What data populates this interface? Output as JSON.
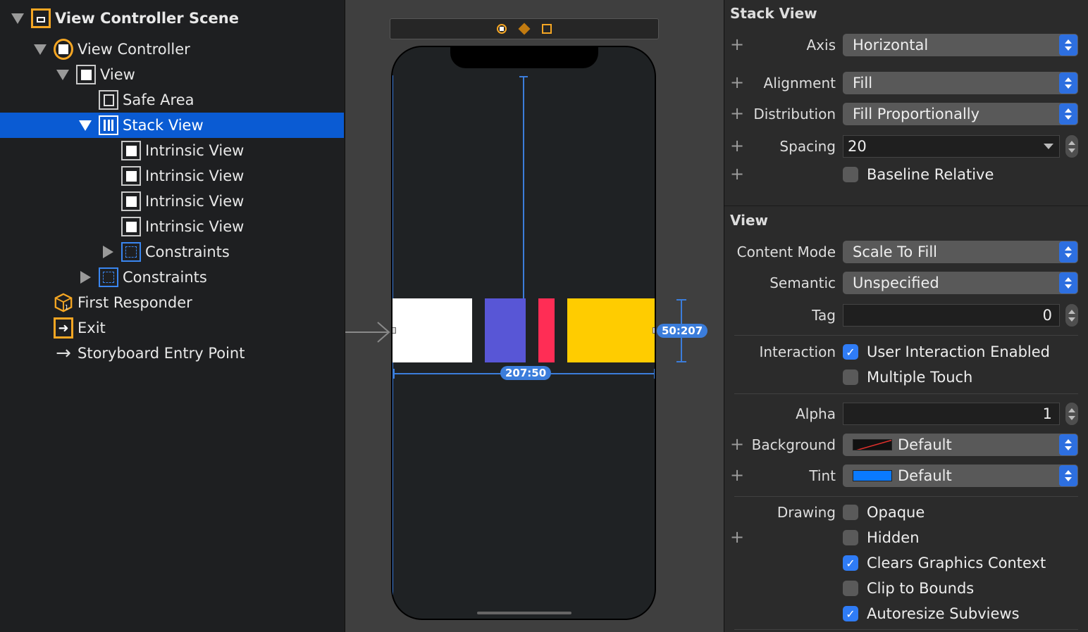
{
  "outline": {
    "scene": "View Controller Scene",
    "view_controller": "View Controller",
    "view": "View",
    "safe_area": "Safe Area",
    "stack_view": "Stack View",
    "intrinsic_views": [
      "Intrinsic View",
      "Intrinsic View",
      "Intrinsic View",
      "Intrinsic View"
    ],
    "stack_constraints": "Constraints",
    "view_constraints": "Constraints",
    "first_responder": "First Responder",
    "exit": "Exit",
    "entry_point": "Storyboard Entry Point"
  },
  "canvas": {
    "stack_items": [
      {
        "color": "#ffffff"
      },
      {
        "color": "#5856d6"
      },
      {
        "color": "#ff2d55"
      },
      {
        "color": "#ffcc00"
      }
    ],
    "width_badge": "207:50",
    "height_badge": "50:207",
    "guide_color": "#3b7ddb"
  },
  "inspector": {
    "stack_view": {
      "title": "Stack View",
      "axis_label": "Axis",
      "axis_value": "Horizontal",
      "alignment_label": "Alignment",
      "alignment_value": "Fill",
      "distribution_label": "Distribution",
      "distribution_value": "Fill Proportionally",
      "spacing_label": "Spacing",
      "spacing_value": "20",
      "baseline_label": "Baseline Relative",
      "baseline_checked": false
    },
    "view": {
      "title": "View",
      "content_mode_label": "Content Mode",
      "content_mode_value": "Scale To Fill",
      "semantic_label": "Semantic",
      "semantic_value": "Unspecified",
      "tag_label": "Tag",
      "tag_value": "0",
      "interaction_label": "Interaction",
      "user_interaction": "User Interaction Enabled",
      "user_interaction_checked": true,
      "multiple_touch": "Multiple Touch",
      "multiple_touch_checked": false,
      "alpha_label": "Alpha",
      "alpha_value": "1",
      "background_label": "Background",
      "background_value": "Default",
      "tint_label": "Tint",
      "tint_value": "Default",
      "tint_color": "#0a7aff",
      "drawing_label": "Drawing",
      "opaque": "Opaque",
      "opaque_checked": false,
      "hidden": "Hidden",
      "hidden_checked": false,
      "clears": "Clears Graphics Context",
      "clears_checked": true,
      "clip": "Clip to Bounds",
      "clip_checked": false,
      "autoresize": "Autoresize Subviews",
      "autoresize_checked": true
    }
  },
  "colors": {
    "selection": "#0a5bd3",
    "accent": "#f5a623",
    "checkbox_on": "#2f7cf6"
  }
}
